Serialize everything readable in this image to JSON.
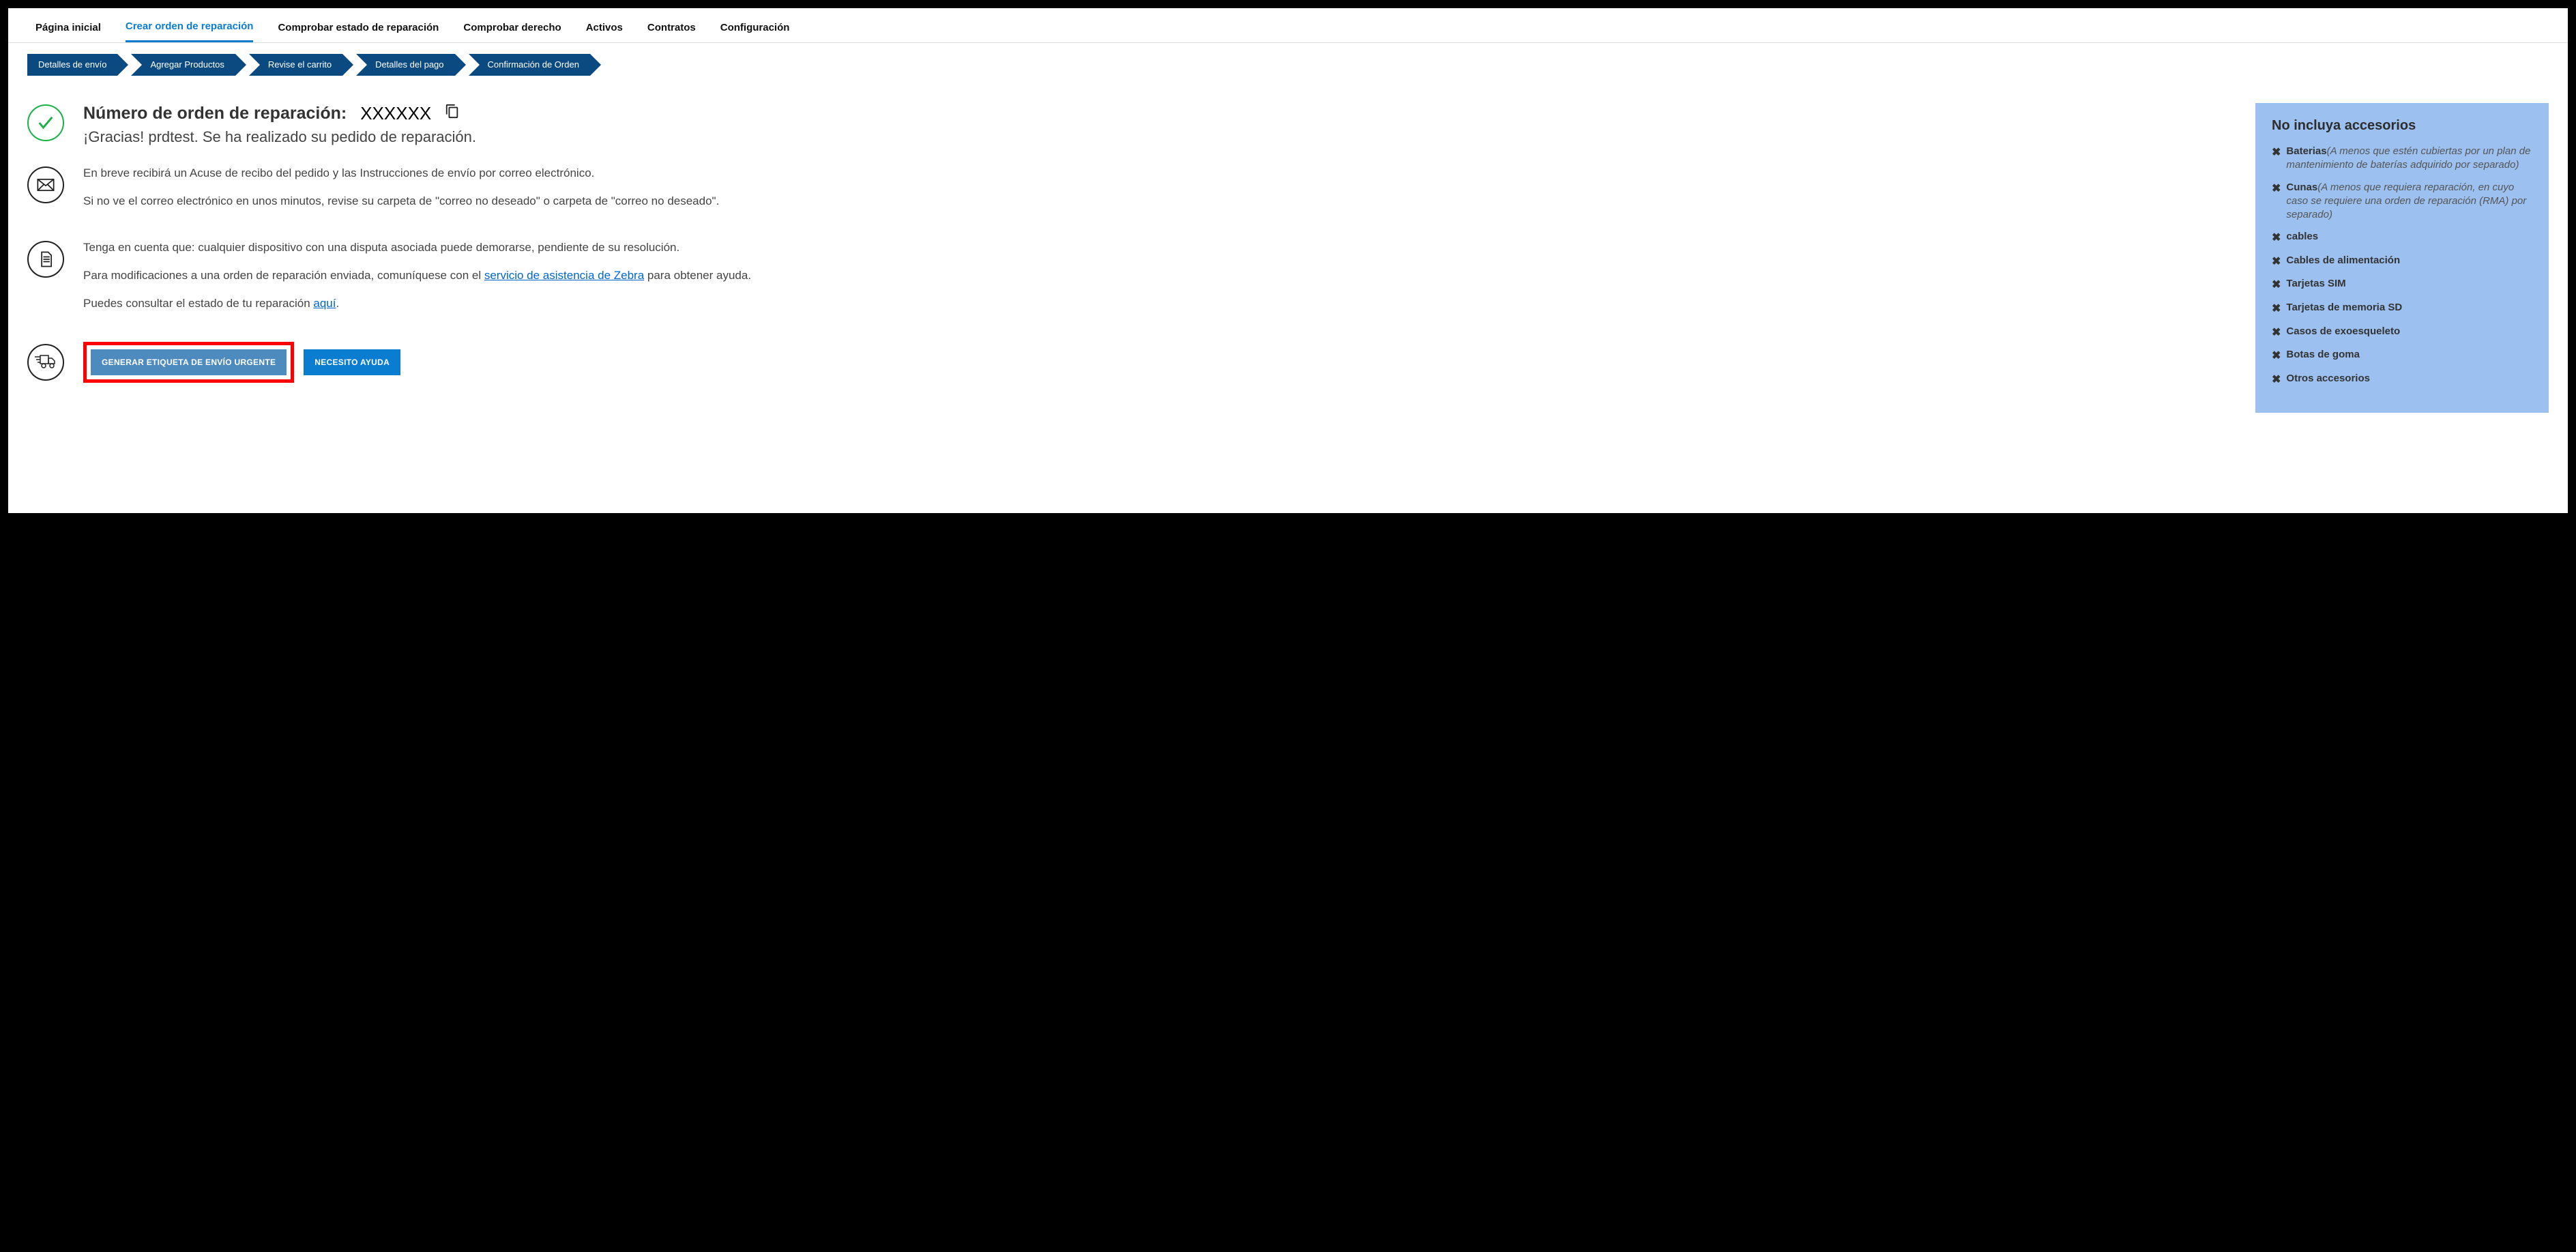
{
  "nav": {
    "items": [
      {
        "label": "Página inicial"
      },
      {
        "label": "Crear orden de reparación",
        "active": true
      },
      {
        "label": "Comprobar estado de reparación"
      },
      {
        "label": "Comprobar derecho"
      },
      {
        "label": "Activos"
      },
      {
        "label": "Contratos"
      },
      {
        "label": "Configuración"
      }
    ]
  },
  "steps": [
    {
      "label": "Detalles de envío"
    },
    {
      "label": "Agregar Productos"
    },
    {
      "label": "Revise el carrito"
    },
    {
      "label": "Detalles del pago"
    },
    {
      "label": "Confirmación de Orden"
    }
  ],
  "order": {
    "heading_label": "Número de orden de reparación:",
    "number": "XXXXXX",
    "thanks": "¡Gracias! prdtest. Se ha realizado su pedido de reparación."
  },
  "email_block": {
    "line1": "En breve recibirá un Acuse de recibo del pedido y las Instrucciones de envío por correo electrónico.",
    "line2": "Si no ve el correo electrónico en unos minutos, revise su carpeta de \"correo no deseado\" o carpeta de \"correo no deseado\"."
  },
  "note_block": {
    "line1": "Tenga en cuenta que: cualquier dispositivo con una disputa asociada puede demorarse, pendiente de su resolución.",
    "line2a": "Para modificaciones a una orden de reparación enviada, comuníquese con el ",
    "link1": " servicio de asistencia de Zebra",
    "line2b": " para obtener ayuda.",
    "line3a": "Puedes consultar el estado de tu reparación ",
    "link2": "aquí",
    "line3b": "."
  },
  "buttons": {
    "generate_label": "GENERAR ETIQUETA DE ENVÍO URGENTE",
    "help": "NECESITO AYUDA"
  },
  "panel": {
    "title": "No incluya accesorios",
    "items": [
      {
        "label": "Baterias",
        "note": "(A menos que estén cubiertas por un plan de mantenimiento de baterías adquirido por separado)"
      },
      {
        "label": "Cunas",
        "note": "(A menos que requiera reparación, en cuyo caso se requiere una orden de reparación (RMA) por separado)"
      },
      {
        "label": "cables",
        "note": ""
      },
      {
        "label": "Cables de alimentación",
        "note": ""
      },
      {
        "label": "Tarjetas SIM",
        "note": ""
      },
      {
        "label": "Tarjetas de memoria SD",
        "note": ""
      },
      {
        "label": "Casos de exoesqueleto",
        "note": ""
      },
      {
        "label": "Botas de goma",
        "note": ""
      },
      {
        "label": "Otros accesorios",
        "note": ""
      }
    ]
  }
}
